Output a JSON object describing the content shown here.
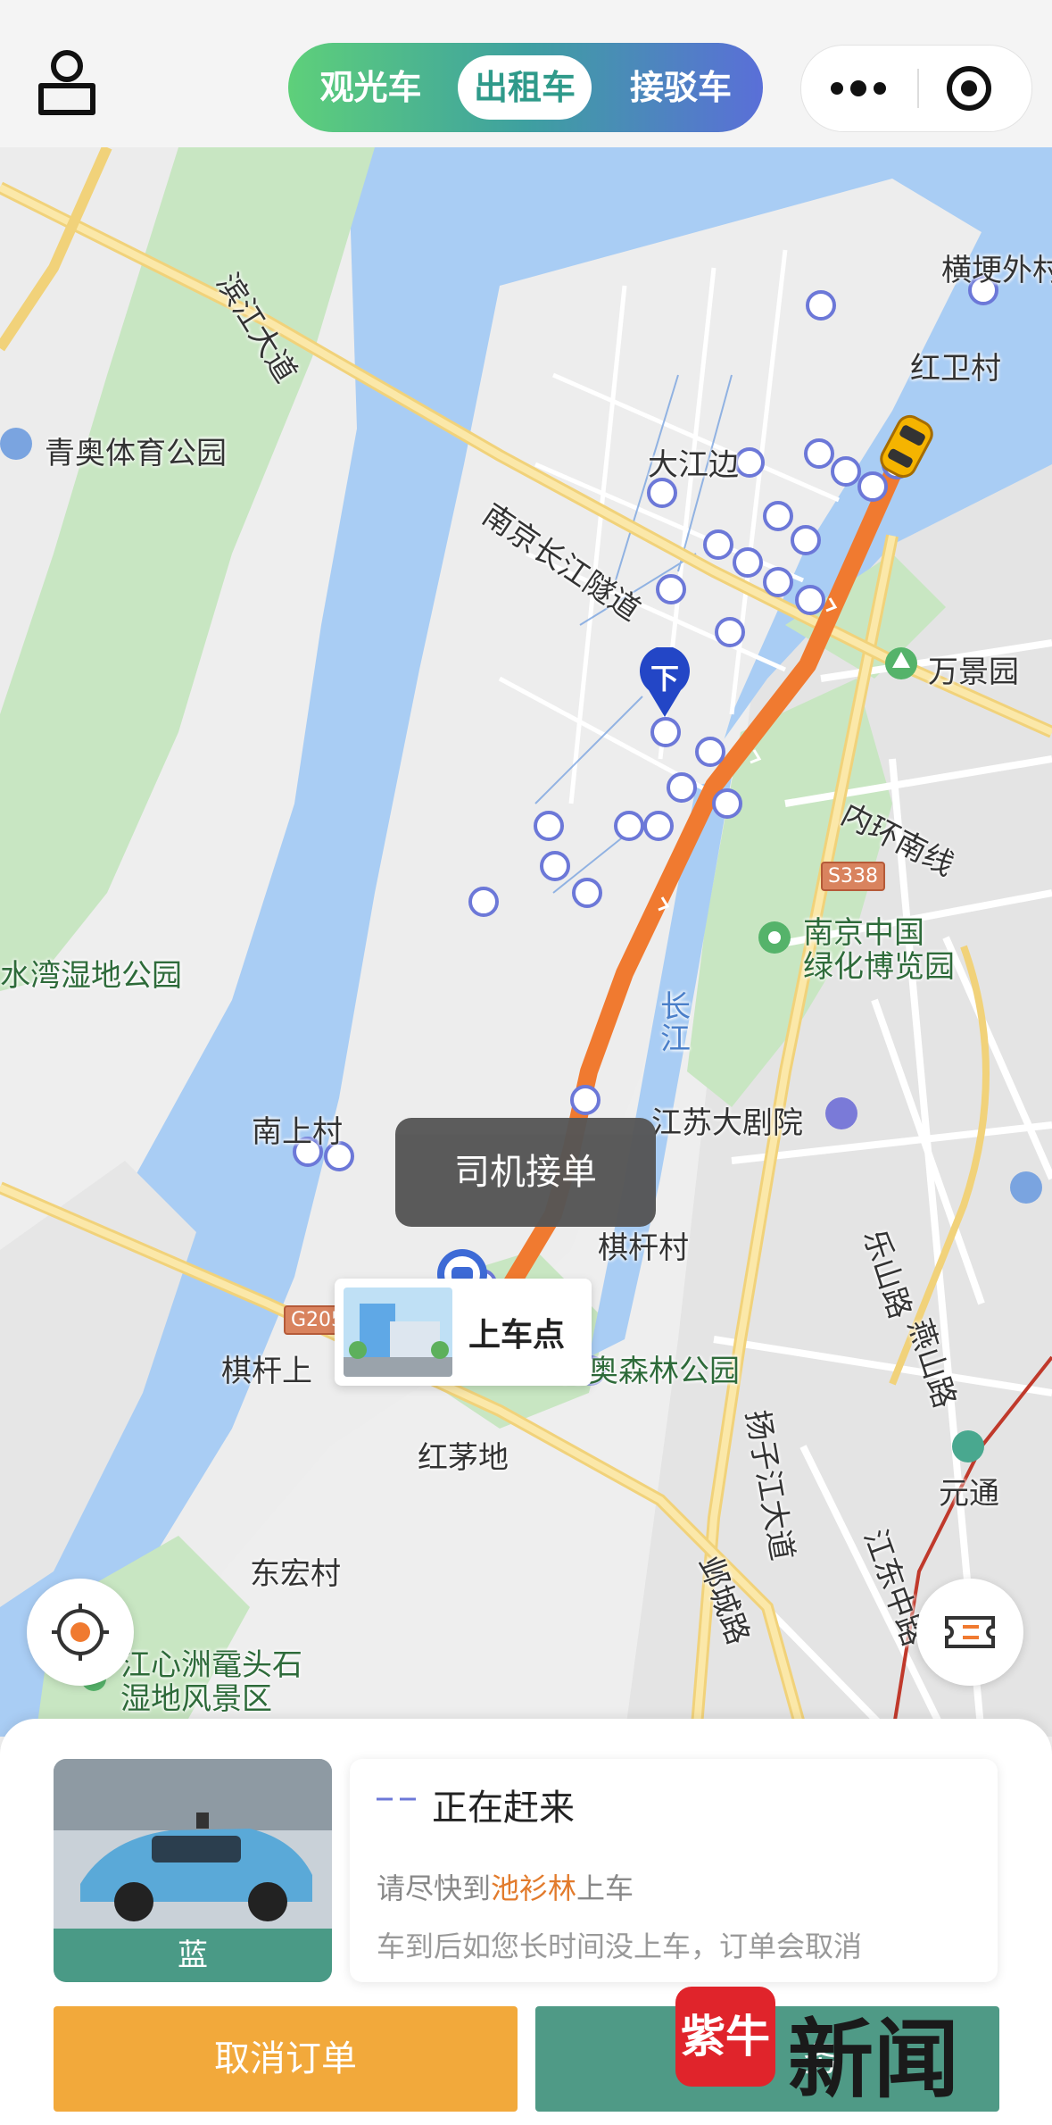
{
  "tabs": [
    {
      "label": "观光车"
    },
    {
      "label": "出租车",
      "active": true
    },
    {
      "label": "接驳车"
    }
  ],
  "map": {
    "labels": {
      "l1": "横埂外村",
      "l2": "红卫村",
      "l3": "大江边",
      "l4": "青奥体育公园",
      "l5": "南京长江隧道",
      "l6": "万景园",
      "l7": "内环南线",
      "l8": "S338",
      "l9": "南京中国",
      "l10": "绿化博览园",
      "l11": "水湾湿地公园",
      "l12": "长江",
      "l13": "江苏大剧院",
      "l14": "南上村",
      "l15": "棋杆村",
      "l16": "G205",
      "l17": "棋杆上",
      "l18": "青奥森林公园",
      "l19": "红茅地",
      "l20": "乐山路",
      "l21": "燕山路",
      "l22": "元通",
      "l23": "扬子江大道",
      "l24": "邺城路",
      "l25": "江东中路",
      "l26": "东宏村",
      "l27": "江心洲鼋头石",
      "l28": "湿地风景区",
      "l29": "滨江大道"
    },
    "dropoff_marker": "下",
    "toast": "司机接单",
    "pickup_label": "上车点"
  },
  "panel": {
    "car_color": "蓝",
    "status_title": "正在赶来",
    "line1_prefix": "请尽快到",
    "line1_place": "池衫林",
    "line1_suffix": "上车",
    "line2": "车到后如您长时间没上车，订单会取消",
    "cancel_label": "取消订单",
    "contact_label": "务"
  },
  "watermark": {
    "logo": "紫牛",
    "text": "新闻"
  },
  "colors": {
    "route": "#f07a30",
    "accent_green": "#4f9a86",
    "cancel_orange": "#f2a93b",
    "river": "#a9cdf4",
    "park": "#c8e6c2"
  }
}
